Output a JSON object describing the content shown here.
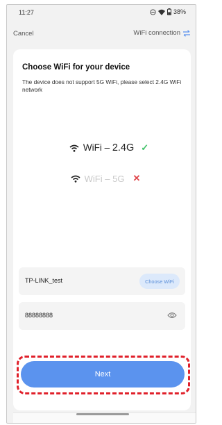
{
  "status_bar": {
    "time": "11:27",
    "battery": "38%",
    "icons": [
      "do-not-disturb-icon",
      "wifi-icon",
      "battery-icon"
    ]
  },
  "nav": {
    "cancel_label": "Cancel",
    "title": "WiFi connection",
    "switch_icon": "swap-arrows-icon"
  },
  "card": {
    "title": "Choose WiFi for your device",
    "description": "The device does not support 5G WiFi, please select 2.4G WiFi network",
    "bands": [
      {
        "prefix": "WiFi – ",
        "band": "2.4G",
        "supported": true
      },
      {
        "prefix": "WiFi – ",
        "band": "5G",
        "supported": false
      }
    ]
  },
  "form": {
    "ssid_value": "TP-LINK_test",
    "choose_wifi_label": "Choose WiFi",
    "password_value": "88888888"
  },
  "actions": {
    "next_label": "Next"
  },
  "colors": {
    "accent": "#5b93ee",
    "ok": "#43c36a",
    "error": "#e0474c",
    "highlight": "#e0202a"
  }
}
